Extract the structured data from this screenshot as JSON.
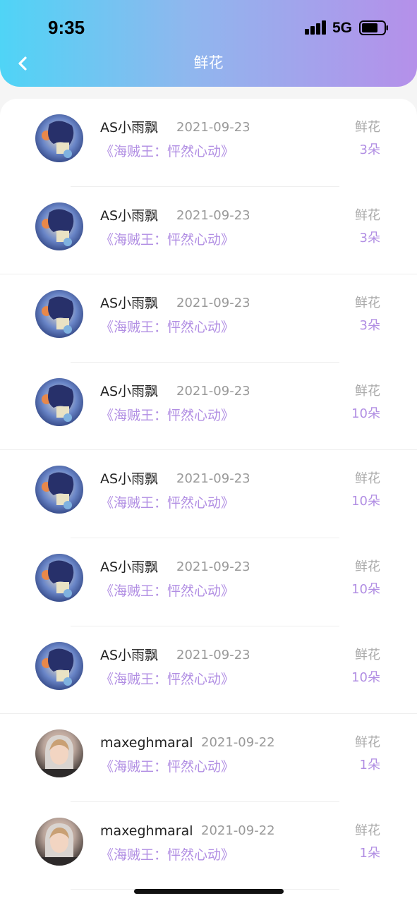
{
  "status_bar": {
    "time": "9:35",
    "network": "5G"
  },
  "header": {
    "title": "鲜花"
  },
  "colors": {
    "accent": "#b18ee3",
    "gradient_start": "#4fd4f6",
    "gradient_end": "#b590ea"
  },
  "items": [
    {
      "name": "AS小雨飘",
      "date": "2021-09-23",
      "movie": "《海贼王：怦然心动》",
      "gift_label": "鲜花",
      "gift_count": "3朵",
      "avatar": "anime-avatar"
    },
    {
      "name": "AS小雨飘",
      "date": "2021-09-23",
      "movie": "《海贼王：怦然心动》",
      "gift_label": "鲜花",
      "gift_count": "3朵",
      "avatar": "anime-avatar"
    },
    {
      "name": "AS小雨飘",
      "date": "2021-09-23",
      "movie": "《海贼王：怦然心动》",
      "gift_label": "鲜花",
      "gift_count": "3朵",
      "avatar": "anime-avatar"
    },
    {
      "name": "AS小雨飘",
      "date": "2021-09-23",
      "movie": "《海贼王：怦然心动》",
      "gift_label": "鲜花",
      "gift_count": "10朵",
      "avatar": "anime-avatar"
    },
    {
      "name": "AS小雨飘",
      "date": "2021-09-23",
      "movie": "《海贼王：怦然心动》",
      "gift_label": "鲜花",
      "gift_count": "10朵",
      "avatar": "anime-avatar"
    },
    {
      "name": "AS小雨飘",
      "date": "2021-09-23",
      "movie": "《海贼王：怦然心动》",
      "gift_label": "鲜花",
      "gift_count": "10朵",
      "avatar": "anime-avatar"
    },
    {
      "name": "AS小雨飘",
      "date": "2021-09-23",
      "movie": "《海贼王：怦然心动》",
      "gift_label": "鲜花",
      "gift_count": "10朵",
      "avatar": "anime-avatar"
    },
    {
      "name": "maxeghmaral",
      "date": "2021-09-22",
      "movie": "《海贼王：怦然心动》",
      "gift_label": "鲜花",
      "gift_count": "1朵",
      "avatar": "photo-avatar"
    },
    {
      "name": "maxeghmaral",
      "date": "2021-09-22",
      "movie": "《海贼王：怦然心动》",
      "gift_label": "鲜花",
      "gift_count": "1朵",
      "avatar": "photo-avatar"
    }
  ]
}
